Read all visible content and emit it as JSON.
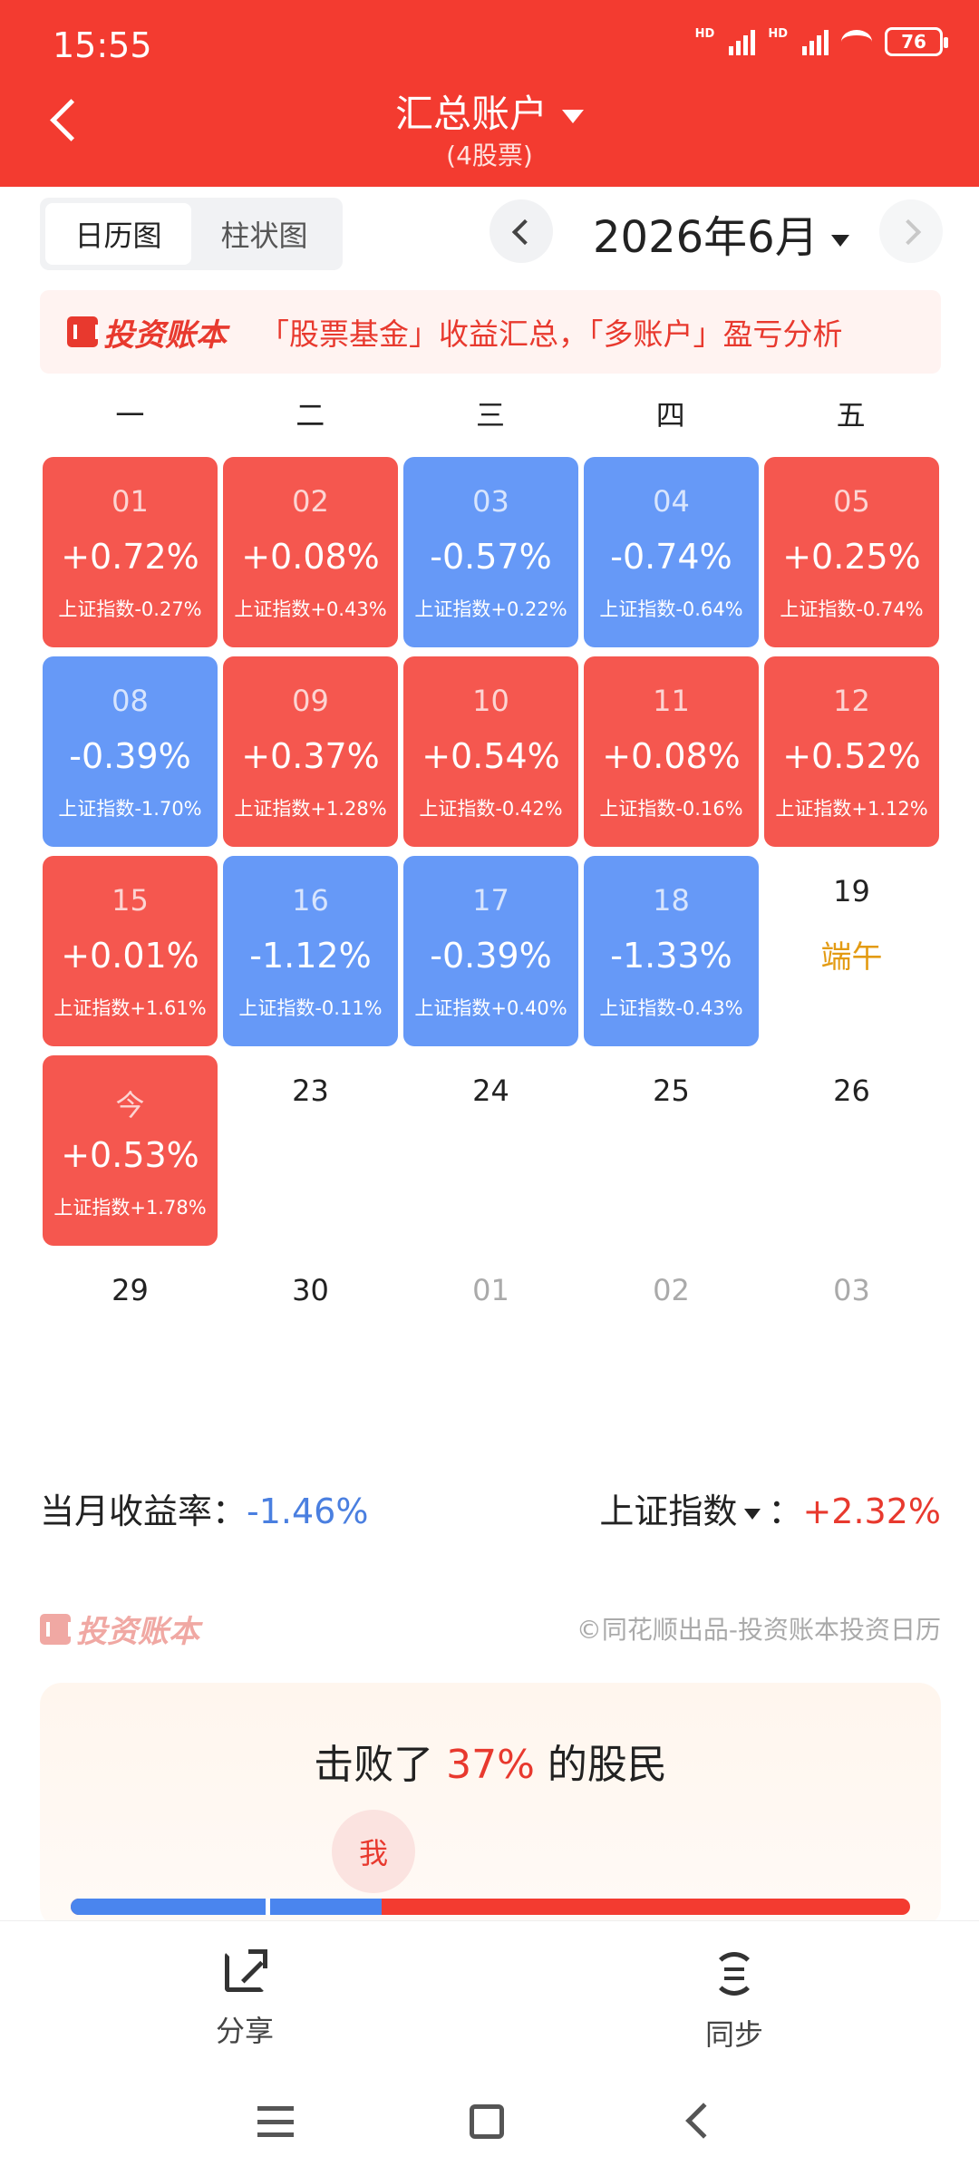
{
  "status_bar": {
    "time": "15:55",
    "hd": "HD",
    "battery": "76"
  },
  "header": {
    "title": "汇总账户",
    "subtitle": "(4股票)"
  },
  "toolbar": {
    "tabs": [
      {
        "label": "日历图",
        "active": true
      },
      {
        "label": "柱状图",
        "active": false
      }
    ],
    "month": "2026年6月"
  },
  "banner": {
    "logo": "投资账本",
    "text": "「股票基金」收益汇总，「多账户」盈亏分析"
  },
  "weekdays": [
    "一",
    "二",
    "三",
    "四",
    "五"
  ],
  "calendar": [
    {
      "day": "01",
      "ret": "+0.72%",
      "idx": "上证指数-0.27%",
      "type": "up"
    },
    {
      "day": "02",
      "ret": "+0.08%",
      "idx": "上证指数+0.43%",
      "type": "up"
    },
    {
      "day": "03",
      "ret": "-0.57%",
      "idx": "上证指数+0.22%",
      "type": "down"
    },
    {
      "day": "04",
      "ret": "-0.74%",
      "idx": "上证指数-0.64%",
      "type": "down"
    },
    {
      "day": "05",
      "ret": "+0.25%",
      "idx": "上证指数-0.74%",
      "type": "up"
    },
    {
      "day": "08",
      "ret": "-0.39%",
      "idx": "上证指数-1.70%",
      "type": "down"
    },
    {
      "day": "09",
      "ret": "+0.37%",
      "idx": "上证指数+1.28%",
      "type": "up"
    },
    {
      "day": "10",
      "ret": "+0.54%",
      "idx": "上证指数-0.42%",
      "type": "up"
    },
    {
      "day": "11",
      "ret": "+0.08%",
      "idx": "上证指数-0.16%",
      "type": "up"
    },
    {
      "day": "12",
      "ret": "+0.52%",
      "idx": "上证指数+1.12%",
      "type": "up"
    },
    {
      "day": "15",
      "ret": "+0.01%",
      "idx": "上证指数+1.61%",
      "type": "up"
    },
    {
      "day": "16",
      "ret": "-1.12%",
      "idx": "上证指数-0.11%",
      "type": "down"
    },
    {
      "day": "17",
      "ret": "-0.39%",
      "idx": "上证指数+0.40%",
      "type": "down"
    },
    {
      "day": "18",
      "ret": "-1.33%",
      "idx": "上证指数-0.43%",
      "type": "down"
    },
    {
      "day": "19",
      "holiday": "端午",
      "type": "empty"
    },
    {
      "day": "今",
      "ret": "+0.53%",
      "idx": "上证指数+1.78%",
      "type": "up"
    },
    {
      "day": "23",
      "type": "empty"
    },
    {
      "day": "24",
      "type": "empty"
    },
    {
      "day": "25",
      "type": "empty"
    },
    {
      "day": "26",
      "type": "empty"
    },
    {
      "day": "29",
      "type": "empty"
    },
    {
      "day": "30",
      "type": "empty"
    },
    {
      "day": "01",
      "type": "muted"
    },
    {
      "day": "02",
      "type": "muted"
    },
    {
      "day": "03",
      "type": "muted"
    }
  ],
  "summary": {
    "month_label": "当月收益率：",
    "month_value": "-1.46%",
    "index_label": "上证指数",
    "index_value": "+2.32%"
  },
  "footer": {
    "logo": "投资账本",
    "credit": "©同花顺出品-投资账本投资日历"
  },
  "beat": {
    "prefix": "击败了",
    "percent": "37%",
    "suffix": "的股民",
    "me": "我",
    "fraction": 0.37
  },
  "bottom_nav": {
    "share": "分享",
    "sync": "同步"
  },
  "colors": {
    "brand": "#f33b30",
    "up": "#f5574f",
    "down": "#6699f7",
    "holiday": "#e39b13"
  }
}
